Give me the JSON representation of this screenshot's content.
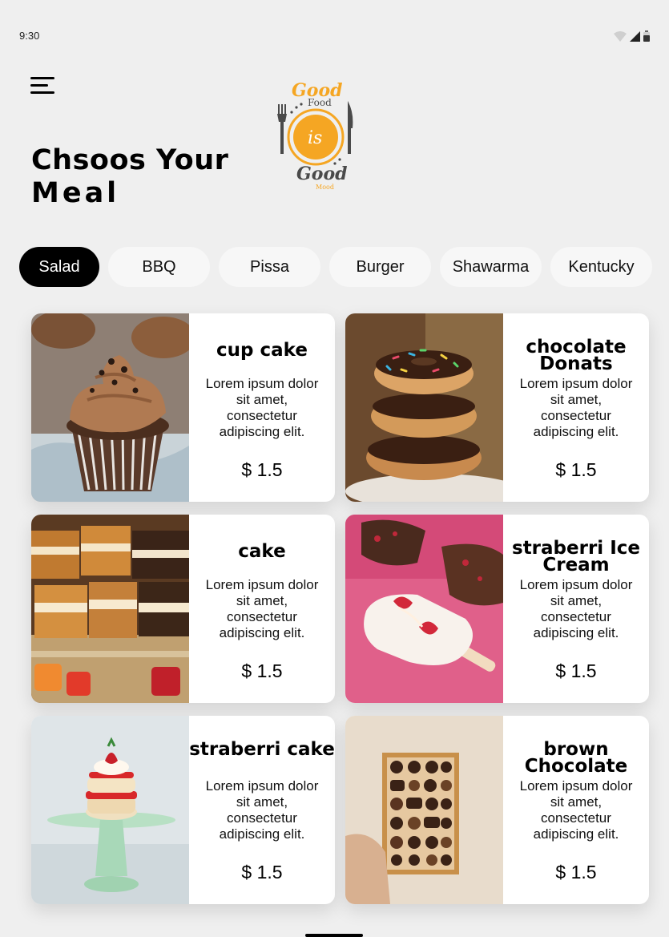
{
  "status_bar": {
    "time": "9:30"
  },
  "header": {
    "menu_icon": "hamburger-menu-icon",
    "title_line1": "Chsoos Your",
    "title_line2": "Meal"
  },
  "logo": {
    "text_top": "Good",
    "text_food": "Food",
    "text_center": "is",
    "text_bottom": "Good",
    "text_small": "Mood"
  },
  "categories": [
    {
      "label": "Salad",
      "active": true
    },
    {
      "label": "BBQ",
      "active": false
    },
    {
      "label": "Pissa",
      "active": false
    },
    {
      "label": "Burger",
      "active": false
    },
    {
      "label": "Shawarma",
      "active": false
    },
    {
      "label": "Kentucky",
      "active": false
    }
  ],
  "items": [
    {
      "name": "cup cake",
      "description": "Lorem ipsum dolor sit amet, consectetur adipiscing elit.",
      "price": "$ 1.5",
      "image": "cupcake-photo"
    },
    {
      "name": "chocolate Donats",
      "description": "Lorem ipsum dolor sit amet, consectetur adipiscing elit.",
      "price": "$ 1.5",
      "image": "donuts-photo"
    },
    {
      "name": "cake",
      "description": "Lorem ipsum dolor sit amet, consectetur adipiscing elit.",
      "price": "$ 1.5",
      "image": "cake-slices-photo"
    },
    {
      "name": "straberri Ice Cream",
      "description": "Lorem ipsum dolor sit amet, consectetur adipiscing elit.",
      "price": "$ 1.5",
      "image": "strawberry-ice-cream-photo"
    },
    {
      "name": "straberri cake",
      "description": "Lorem ipsum dolor sit amet, consectetur adipiscing elit.",
      "price": "$ 1.5",
      "image": "strawberry-cake-photo"
    },
    {
      "name": "brown Chocolate",
      "description": "Lorem ipsum dolor sit amet, consectetur adipiscing elit.",
      "price": "$ 1.5",
      "image": "chocolate-box-photo"
    }
  ],
  "colors": {
    "background": "#efefef",
    "active_chip": "#000000",
    "chip": "#f7f7f7",
    "logo_orange": "#f5a623"
  }
}
